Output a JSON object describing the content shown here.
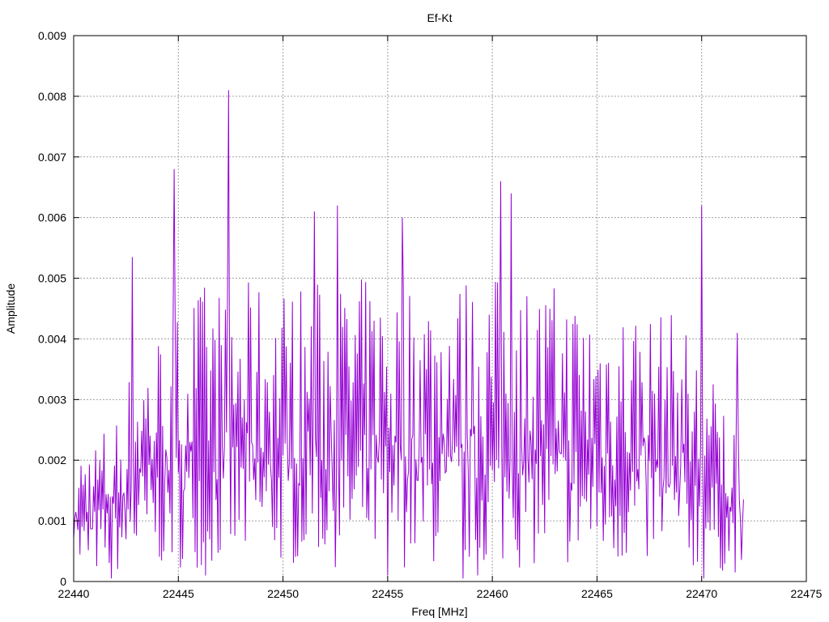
{
  "chart_data": {
    "type": "line",
    "title": "Ef-Kt",
    "xlabel": "Freq [MHz]",
    "ylabel": "Amplitude",
    "xlim": [
      22440,
      22475
    ],
    "ylim": [
      0,
      0.009
    ],
    "x_ticks": [
      "22440",
      "22445",
      "22450",
      "22455",
      "22460",
      "22465",
      "22470",
      "22475"
    ],
    "y_ticks": [
      "0",
      "0.001",
      "0.002",
      "0.003",
      "0.004",
      "0.005",
      "0.006",
      "0.007",
      "0.008",
      "0.009"
    ],
    "grid": true,
    "line_color": "#9400d3",
    "series": [
      {
        "name": "",
        "x_start": 22440,
        "x_end": 22472,
        "x_step": 0.1,
        "peaks": [
          {
            "x": 22442.8,
            "y": 0.00535
          },
          {
            "x": 22444.8,
            "y": 0.0068
          },
          {
            "x": 22447.4,
            "y": 0.0081
          },
          {
            "x": 22451.5,
            "y": 0.0061
          },
          {
            "x": 22452.6,
            "y": 0.0062
          },
          {
            "x": 22455.7,
            "y": 0.006
          },
          {
            "x": 22458.6,
            "y": 0.0062
          },
          {
            "x": 22460.4,
            "y": 0.0066
          },
          {
            "x": 22460.9,
            "y": 0.0064
          },
          {
            "x": 22470.0,
            "y": 0.0062
          },
          {
            "x": 22471.7,
            "y": 0.0041
          }
        ],
        "troughs": [
          {
            "x": 22441.8,
            "y": 5e-05
          },
          {
            "x": 22446.3,
            "y": 0.0001
          },
          {
            "x": 22455.0,
            "y": 0.0001
          },
          {
            "x": 22458.6,
            "y": 5e-05
          },
          {
            "x": 22459.3,
            "y": 0.0001
          },
          {
            "x": 22470.1,
            "y": 5e-05
          }
        ],
        "envelope": [
          {
            "x": 22440,
            "y": 0.002
          },
          {
            "x": 22442,
            "y": 0.0025
          },
          {
            "x": 22443,
            "y": 0.0035
          },
          {
            "x": 22446,
            "y": 0.0045
          },
          {
            "x": 22450,
            "y": 0.0045
          },
          {
            "x": 22456,
            "y": 0.0046
          },
          {
            "x": 22461,
            "y": 0.0046
          },
          {
            "x": 22466,
            "y": 0.0043
          },
          {
            "x": 22469,
            "y": 0.004
          },
          {
            "x": 22471,
            "y": 0.0028
          },
          {
            "x": 22472,
            "y": 0.0025
          }
        ],
        "seed": 7
      }
    ]
  }
}
